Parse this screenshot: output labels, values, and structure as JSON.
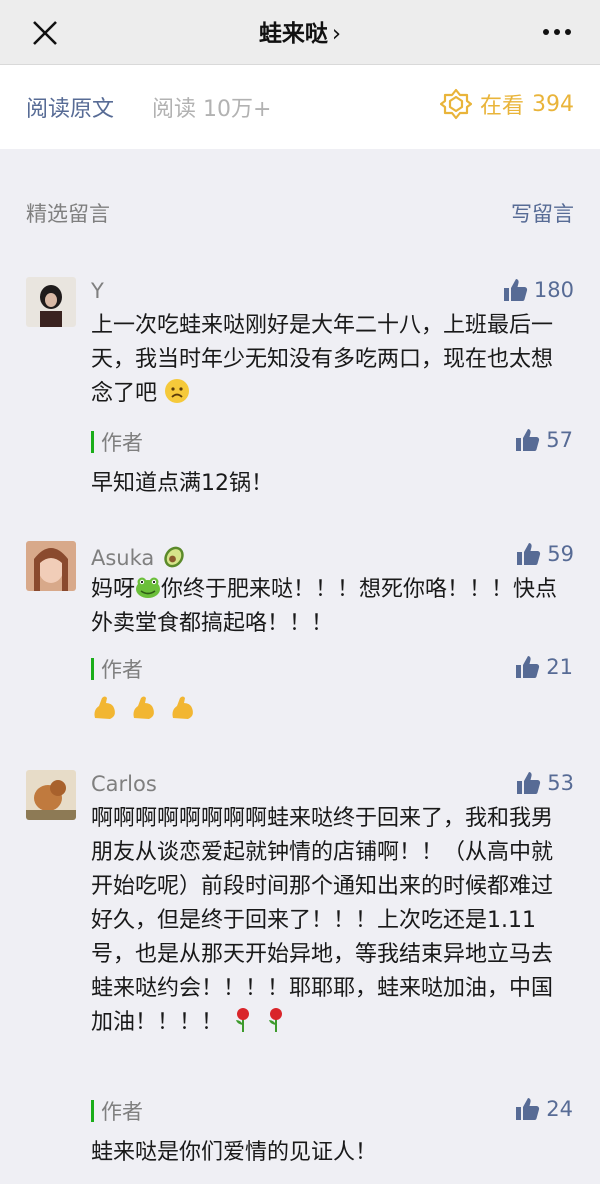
{
  "header": {
    "title": "蛙来哒",
    "title_chevron": "›"
  },
  "readbar": {
    "read_original": "阅读原文",
    "read_count": "阅读 10万+",
    "wow_label": "在看",
    "wow_count": "394"
  },
  "section": {
    "title": "精选留言",
    "write_label": "写留言"
  },
  "comments": [
    {
      "nickname": "Y",
      "likes": "180",
      "text": "上一次吃蛙来哒刚好是大年二十八，上班最后一天，我当时年少无知没有多吃两口，现在也太想念了吧",
      "reply": {
        "author": "作者",
        "likes": "57",
        "text": "早知道点满12锅！"
      }
    },
    {
      "nickname": "Asuka",
      "likes": "59",
      "text_a": "妈呀",
      "text_b": "你终于肥来哒！！！想死你咯！！！快点外卖堂食都搞起咯！！！",
      "reply": {
        "author": "作者",
        "likes": "21"
      }
    },
    {
      "nickname": "Carlos",
      "likes": "53",
      "text": "啊啊啊啊啊啊啊啊蛙来哒终于回来了，我和我男朋友从谈恋爱起就钟情的店铺啊！！（从高中就开始吃呢）前段时间那个通知出来的时候都难过好久，但是终于回来了！！！上次吃还是1.11号，也是从那天开始异地，等我结束异地立马去蛙来哒约会！！！！耶耶耶，蛙来哒加油，中国加油！！！！",
      "reply": {
        "author": "作者",
        "likes": "24",
        "text": "蛙来哒是你们爱情的见证人！"
      }
    }
  ],
  "colors": {
    "link": "#576b95",
    "wow": "#e9b43a",
    "author_bar": "#1aad19",
    "background": "#efeff4"
  }
}
